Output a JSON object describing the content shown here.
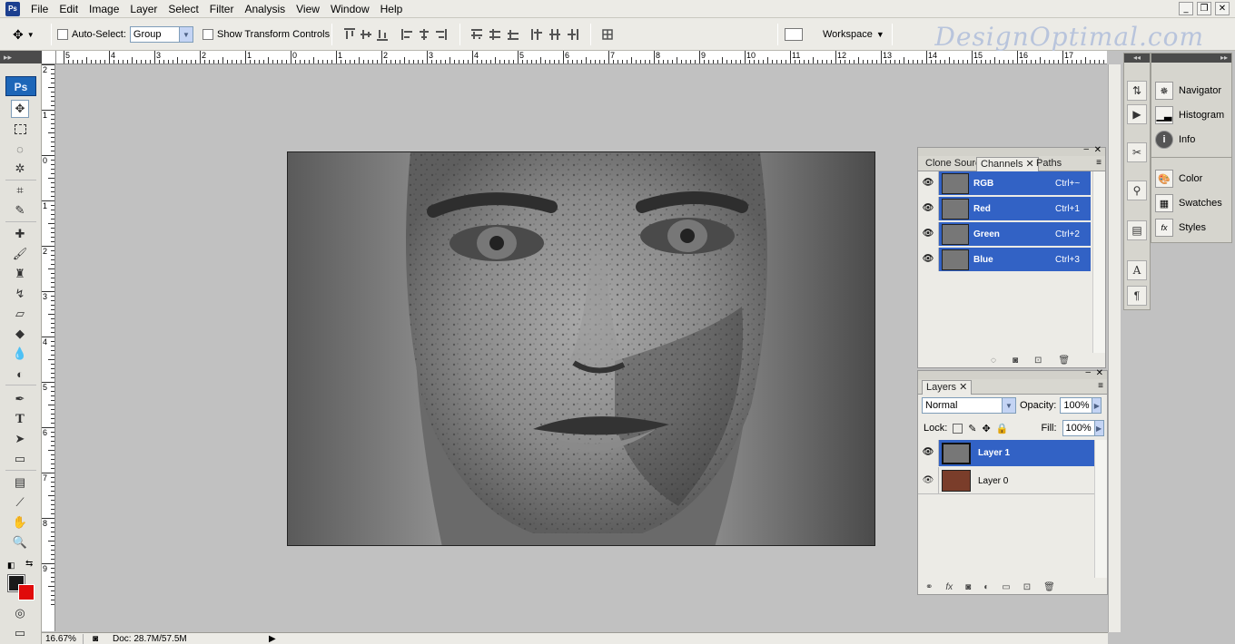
{
  "menu": [
    "File",
    "Edit",
    "Image",
    "Layer",
    "Select",
    "Filter",
    "Analysis",
    "View",
    "Window",
    "Help"
  ],
  "app_badge": "Ps",
  "window_controls": [
    "_",
    "❐",
    "✕"
  ],
  "options": {
    "auto_select_label": "Auto-Select:",
    "auto_select_value": "Group",
    "show_transform_label": "Show Transform Controls",
    "workspace_label": "Workspace",
    "brand": "DesignOptimal.com"
  },
  "ruler_h": [
    "5",
    "4",
    "3",
    "2",
    "1",
    "0",
    "1",
    "2",
    "3",
    "4",
    "5",
    "6",
    "7",
    "8",
    "9",
    "10",
    "11",
    "12",
    "13",
    "14",
    "15",
    "16",
    "17"
  ],
  "ruler_v": [
    "2",
    "1",
    "0",
    "1",
    "2",
    "3",
    "4",
    "5",
    "6",
    "7",
    "8",
    "9"
  ],
  "status": {
    "zoom": "16.67%",
    "doc": "Doc: 28.7M/57.5M"
  },
  "channels_panel": {
    "tabs": [
      "Clone Sourc",
      "Channels",
      "Paths"
    ],
    "rows": [
      {
        "name": "RGB",
        "shortcut": "Ctrl+~"
      },
      {
        "name": "Red",
        "shortcut": "Ctrl+1"
      },
      {
        "name": "Green",
        "shortcut": "Ctrl+2"
      },
      {
        "name": "Blue",
        "shortcut": "Ctrl+3"
      }
    ]
  },
  "layers_panel": {
    "tab": "Layers",
    "blend_mode": "Normal",
    "opacity_label": "Opacity:",
    "opacity": "100%",
    "lock_label": "Lock:",
    "fill_label": "Fill:",
    "fill": "100%",
    "layers": [
      {
        "name": "Layer 1",
        "selected": true
      },
      {
        "name": "Layer 0",
        "selected": false
      }
    ]
  },
  "dock": {
    "group1": [
      "Navigator",
      "Histogram",
      "Info"
    ],
    "group2": [
      "Color",
      "Swatches",
      "Styles"
    ]
  },
  "colors": {
    "foreground": "#1a1a1a",
    "background": "#e00b0b",
    "selection": "#3262c5"
  }
}
